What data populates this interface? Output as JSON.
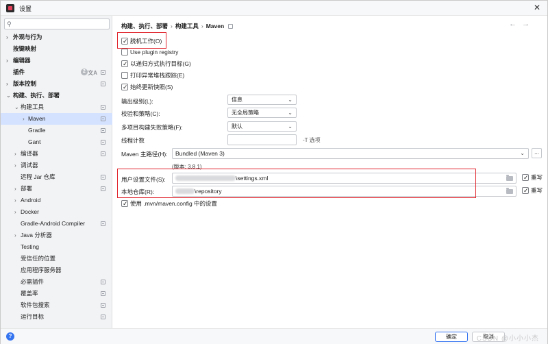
{
  "window": {
    "title": "设置",
    "close_glyph": "✕"
  },
  "sidebar": {
    "search_placeholder": "",
    "items": [
      {
        "label": "外观与行为",
        "bold": true,
        "arrow": "›",
        "level": 0
      },
      {
        "label": "按键映射",
        "bold": true,
        "arrow": "",
        "level": 0
      },
      {
        "label": "编辑器",
        "bold": true,
        "arrow": "›",
        "level": 0
      },
      {
        "label": "插件",
        "bold": true,
        "arrow": "",
        "level": 0,
        "badge": "2"
      },
      {
        "label": "版本控制",
        "bold": true,
        "arrow": "›",
        "level": 0,
        "proj": true
      },
      {
        "label": "构建、执行、部署",
        "bold": true,
        "arrow": "⌄",
        "level": 0
      },
      {
        "label": "构建工具",
        "bold": false,
        "arrow": "⌄",
        "level": 1,
        "proj": true
      },
      {
        "label": "Maven",
        "bold": false,
        "arrow": "›",
        "level": 2,
        "proj": true,
        "selected": true
      },
      {
        "label": "Gradle",
        "bold": false,
        "arrow": "",
        "level": 2,
        "proj": true
      },
      {
        "label": "Gant",
        "bold": false,
        "arrow": "",
        "level": 2,
        "proj": true
      },
      {
        "label": "编译器",
        "bold": false,
        "arrow": "›",
        "level": 1,
        "proj": true
      },
      {
        "label": "调试器",
        "bold": false,
        "arrow": "›",
        "level": 1
      },
      {
        "label": "远程 Jar 仓库",
        "bold": false,
        "arrow": "",
        "level": 1,
        "proj": true
      },
      {
        "label": "部署",
        "bold": false,
        "arrow": "›",
        "level": 1,
        "proj": true
      },
      {
        "label": "Android",
        "bold": false,
        "arrow": "›",
        "level": 1
      },
      {
        "label": "Docker",
        "bold": false,
        "arrow": "›",
        "level": 1
      },
      {
        "label": "Gradle-Android Compiler",
        "bold": false,
        "arrow": "",
        "level": 1,
        "proj": true
      },
      {
        "label": "Java 分析器",
        "bold": false,
        "arrow": "›",
        "level": 1
      },
      {
        "label": "Testing",
        "bold": false,
        "arrow": "",
        "level": 1
      },
      {
        "label": "受信任的位置",
        "bold": false,
        "arrow": "",
        "level": 1
      },
      {
        "label": "应用程序服务器",
        "bold": false,
        "arrow": "",
        "level": 1
      },
      {
        "label": "必需插件",
        "bold": false,
        "arrow": "",
        "level": 1,
        "proj": true
      },
      {
        "label": "覆盖率",
        "bold": false,
        "arrow": "",
        "level": 1,
        "proj": true
      },
      {
        "label": "软件包搜索",
        "bold": false,
        "arrow": "",
        "level": 1,
        "proj": true
      },
      {
        "label": "运行目标",
        "bold": false,
        "arrow": "",
        "level": 1,
        "proj": true
      }
    ]
  },
  "breadcrumb": {
    "part1": "构建、执行、部署",
    "sep": "›",
    "part2": "构建工具",
    "part3": "Maven"
  },
  "nav": {
    "back": "←",
    "forward": "→"
  },
  "options": {
    "offline": {
      "label": "脱机工作(O)",
      "checked": true
    },
    "plugin_registry": {
      "label": "Use plugin registry",
      "checked": false
    },
    "recursive": {
      "label": "以递归方式执行目标(G)",
      "checked": true
    },
    "print_stack": {
      "label": "打印异常堆栈跟踪(E)",
      "checked": false
    },
    "always_update": {
      "label": "始终更新快照(S)",
      "checked": true
    }
  },
  "fields": {
    "output_level": {
      "label": "输出级别(L):",
      "value": "信息"
    },
    "checksum": {
      "label": "校验和策略(C):",
      "value": "无全局策略"
    },
    "multiproject": {
      "label": "多项目构建失败策略(F):",
      "value": "默认"
    },
    "threads": {
      "label": "线程计数",
      "value": "",
      "hint": "-T 选项"
    },
    "maven_home": {
      "label": "Maven 主路径(H):",
      "value": "Bundled (Maven 3)",
      "more": "...",
      "version": "(版本: 3.8.1)"
    },
    "user_settings": {
      "label": "用户设置文件(S):",
      "value": "\\settings.xml",
      "override": "重写",
      "override_checked": true
    },
    "local_repo": {
      "label": "本地仓库(R):",
      "value": "\\repository",
      "override": "重写",
      "override_checked": true
    },
    "use_mvn_config": {
      "label": "使用 .mvn/maven.config 中的设置",
      "checked": true
    }
  },
  "footer": {
    "help": "?",
    "ok": "确定",
    "cancel": "取消",
    "watermark": "CSDN @小小小杰"
  },
  "colors": {
    "accent": "#3574f0",
    "selection": "#d4e2ff",
    "highlight_box": "#e0232b"
  }
}
